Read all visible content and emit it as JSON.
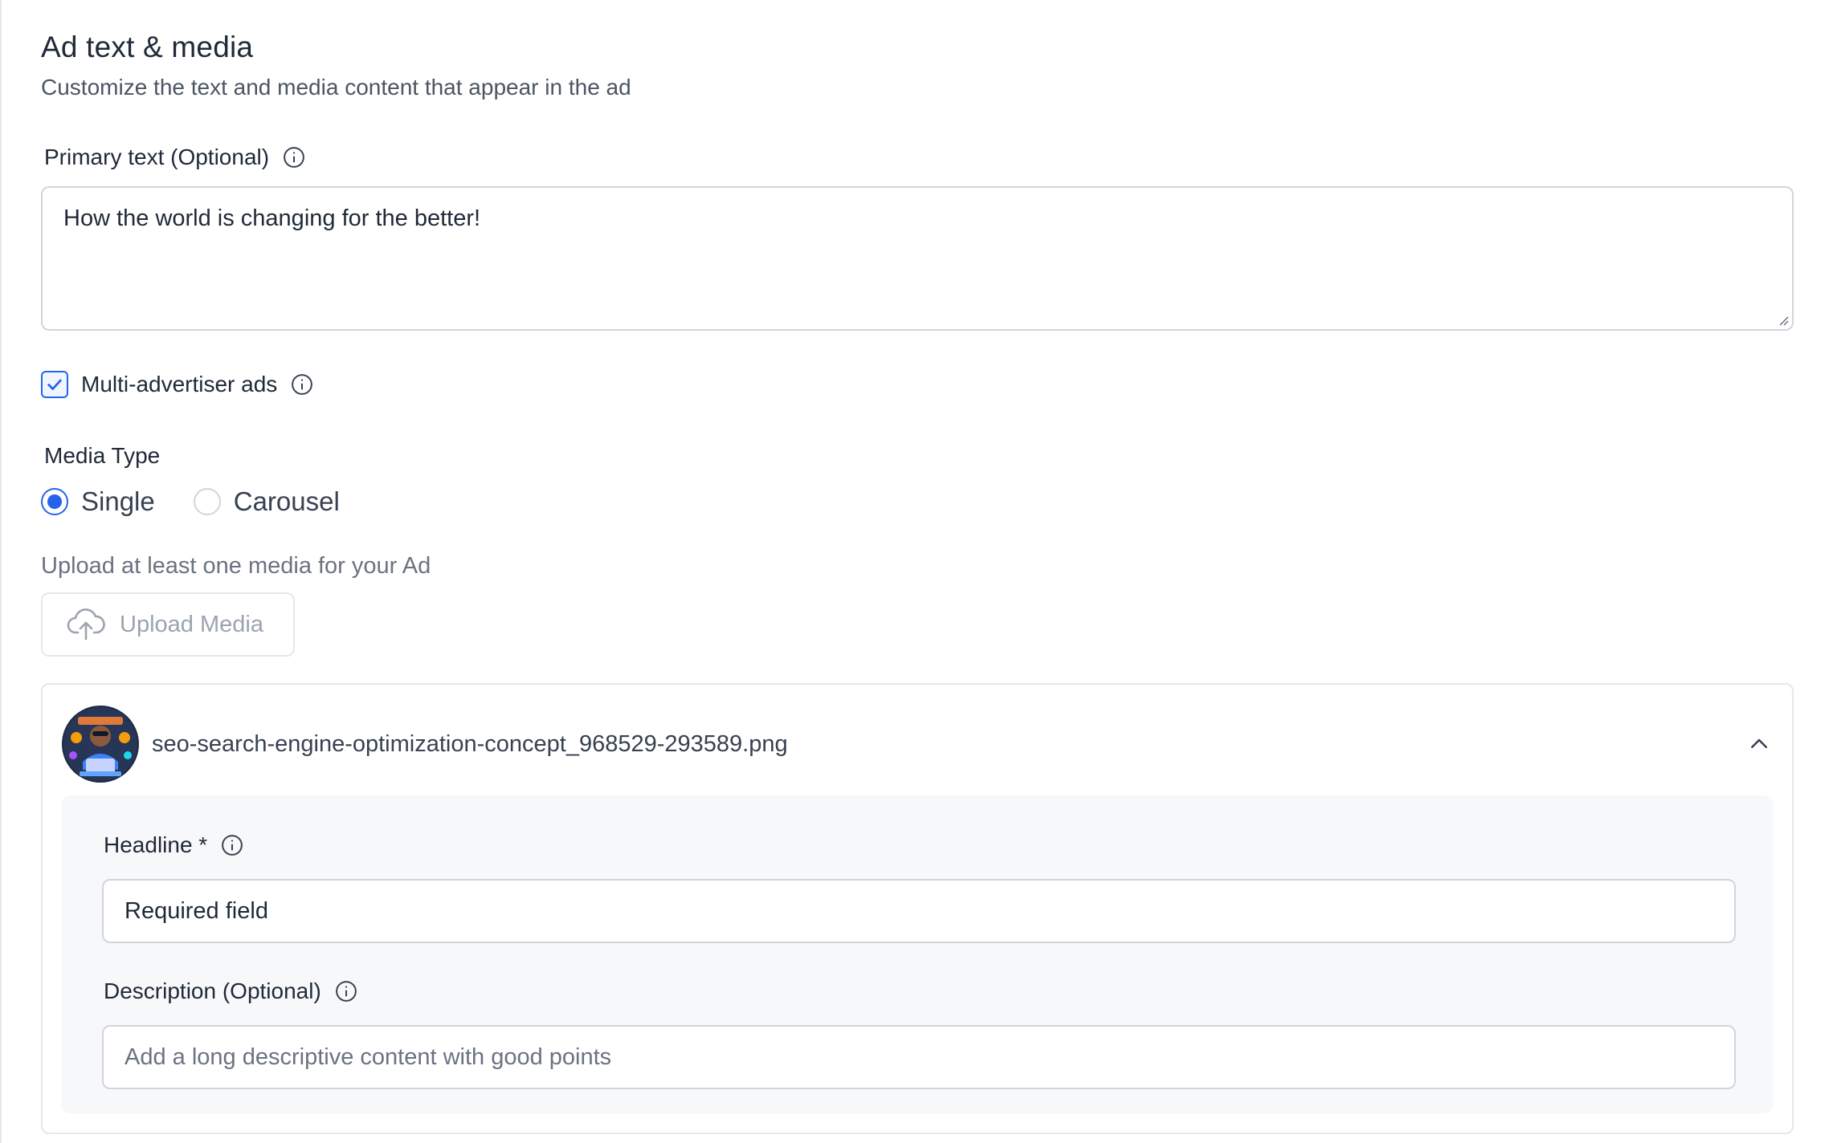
{
  "section": {
    "title": "Ad text & media",
    "subtitle": "Customize the text and media content that appear in the ad"
  },
  "primary_text": {
    "label": "Primary text (Optional)",
    "value": "How the world is changing for the better!"
  },
  "multi_advertiser": {
    "label": "Multi-advertiser ads",
    "checked": true
  },
  "media_type": {
    "label": "Media Type",
    "options": [
      {
        "label": "Single",
        "selected": true
      },
      {
        "label": "Carousel",
        "selected": false
      }
    ]
  },
  "upload": {
    "hint": "Upload at least one media for your Ad",
    "button_label": "Upload Media",
    "icon": "cloud-upload-icon"
  },
  "media_item": {
    "filename": "seo-search-engine-optimization-concept_968529-293589.png",
    "expanded": true,
    "headline": {
      "label": "Headline *",
      "value": "Required field"
    },
    "description": {
      "label": "Description (Optional)",
      "placeholder": "Add a long descriptive content with good points"
    }
  },
  "colors": {
    "accent": "#2563eb",
    "border": "#d1d5db",
    "muted_text": "#6b7280",
    "panel_bg": "#f7f8fa"
  }
}
